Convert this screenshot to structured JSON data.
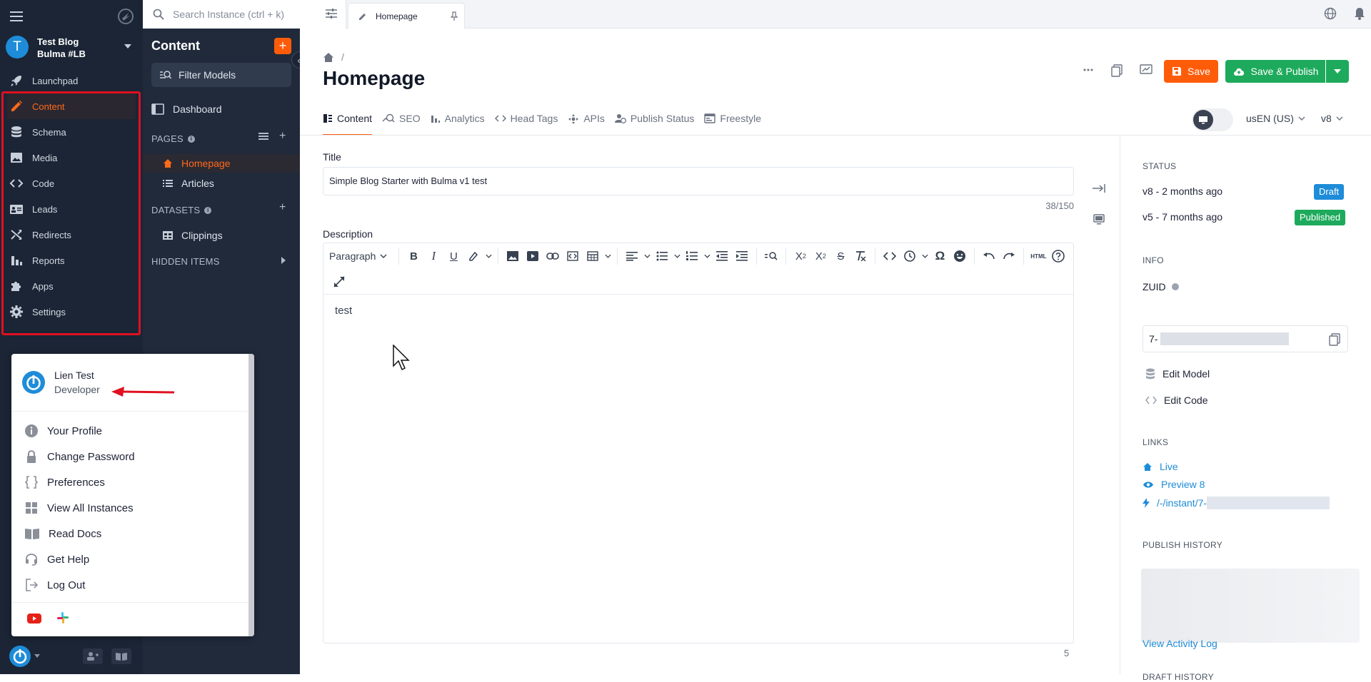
{
  "instance": {
    "initial": "T",
    "name": "Test Blog Bulma #LB"
  },
  "rail": {
    "items": [
      {
        "label": "Launchpad",
        "icon": "rocket-icon"
      },
      {
        "label": "Content",
        "icon": "pencil-icon",
        "active": true
      },
      {
        "label": "Schema",
        "icon": "database-icon"
      },
      {
        "label": "Media",
        "icon": "image-icon"
      },
      {
        "label": "Code",
        "icon": "code-icon"
      },
      {
        "label": "Leads",
        "icon": "contact-card-icon"
      },
      {
        "label": "Redirects",
        "icon": "shuffle-icon"
      },
      {
        "label": "Reports",
        "icon": "bar-chart-icon"
      },
      {
        "label": "Apps",
        "icon": "puzzle-icon"
      },
      {
        "label": "Settings",
        "icon": "gear-icon"
      }
    ]
  },
  "content_sidebar": {
    "title": "Content",
    "filter_label": "Filter Models",
    "dashboard": "Dashboard",
    "pages_header": "PAGES",
    "pages": [
      "Homepage",
      "Articles"
    ],
    "datasets_header": "DATASETS",
    "datasets": [
      "Clippings"
    ],
    "hidden_header": "HIDDEN ITEMS"
  },
  "topbar": {
    "search_placeholder": "Search Instance (ctrl + k)",
    "tab_label": "Homepage"
  },
  "page": {
    "breadcrumb_sep": "/",
    "title": "Homepage",
    "save_label": "Save",
    "publish_label": "Save & Publish",
    "tabs": [
      "Content",
      "SEO",
      "Analytics",
      "Head Tags",
      "APIs",
      "Publish Status",
      "Freestyle"
    ],
    "language": "usEN (US)",
    "version": "v8"
  },
  "form": {
    "title_label": "Title",
    "title_value": "Simple Blog Starter with Bulma v1 test",
    "title_count": "38/150",
    "description_label": "Description",
    "paragraph_select": "Paragraph",
    "editor_body": "test",
    "word_count": "5"
  },
  "right_panel": {
    "status_header": "STATUS",
    "status_rows": [
      {
        "text": "v8 - 2 months ago",
        "badge": "Draft",
        "color": "#1e8cd8"
      },
      {
        "text": "v5 - 7 months ago",
        "badge": "Published",
        "color": "#1eaa5c"
      }
    ],
    "info_header": "INFO",
    "zuid_label": "ZUID",
    "zuid_prefix": "7-",
    "edit_model": "Edit Model",
    "edit_code": "Edit Code",
    "links_header": "LINKS",
    "links": [
      "Live",
      "Preview 8",
      "/-/instant/7-"
    ],
    "publish_history_header": "PUBLISH HISTORY",
    "activity_log": "View Activity Log",
    "draft_history_header": "DRAFT HISTORY"
  },
  "user_menu": {
    "name": "Lien Test",
    "role": "Developer",
    "items": [
      {
        "label": "Your Profile",
        "icon": "info-icon"
      },
      {
        "label": "Change Password",
        "icon": "lock-icon"
      },
      {
        "label": "Preferences",
        "icon": "braces-icon"
      },
      {
        "label": "View All Instances",
        "icon": "grid-icon"
      },
      {
        "label": "Read Docs",
        "icon": "book-icon"
      },
      {
        "label": "Get Help",
        "icon": "headset-icon"
      },
      {
        "label": "Log Out",
        "icon": "logout-icon"
      }
    ]
  },
  "colors": {
    "accent": "#ff5c0a",
    "publish": "#1eaa5c",
    "brand_blue": "#1e8cd8",
    "highlight_red": "#e01020"
  }
}
